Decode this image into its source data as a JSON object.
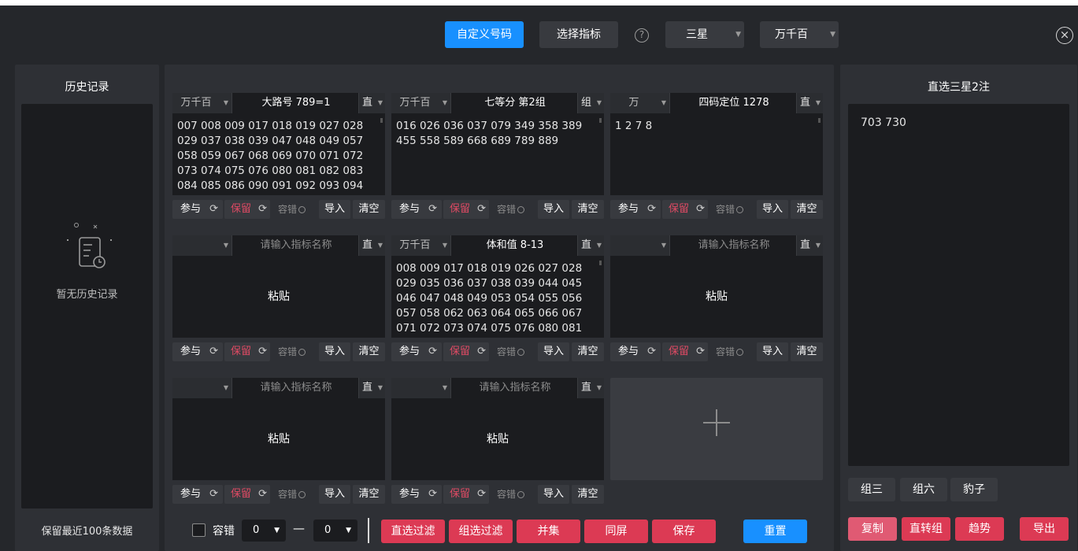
{
  "toolbar": {
    "custom_numbers": "自定义号码",
    "choose_indicator": "选择指标",
    "help": "?",
    "star_select": "三星",
    "position_select": "万千百",
    "close": "×"
  },
  "history": {
    "title": "历史记录",
    "empty": "暂无历史记录",
    "footer": "保留最近100条数据"
  },
  "cards": [
    {
      "pos": "万千百",
      "name": "大路号 789=1",
      "type": "直",
      "body": "007 008 009 017 018 019 027 028 029 037 038 039 047 048 049 057 058 059 067 068 069 070 071 072 073 074 075 076 080 081 082 083 084 085 086 090 091 092 093 094",
      "placeholder": false
    },
    {
      "pos": "万千百",
      "name": "七等分 第2组",
      "type": "组",
      "body": "016 026 036 037 079 349 358 389 455 558 589 668 689 789 889",
      "placeholder": false
    },
    {
      "pos": "万",
      "name": "四码定位 1278",
      "type": "直",
      "body": "1 2 7 8",
      "placeholder": false
    },
    {
      "pos": "",
      "name": "请输入指标名称",
      "type": "直",
      "body": "粘贴",
      "placeholder": true
    },
    {
      "pos": "万千百",
      "name": "体和值 8-13",
      "type": "直",
      "body": "008 009 017 018 019 026 027 028 029 035 036 037 038 039 044 045 046 047 048 049 053 054 055 056 057 058 062 063 064 065 066 067 071 072 073 074 075 076 080 081",
      "placeholder": false
    },
    {
      "pos": "",
      "name": "请输入指标名称",
      "type": "直",
      "body": "粘贴",
      "placeholder": true
    },
    {
      "pos": "",
      "name": "请输入指标名称",
      "type": "直",
      "body": "粘贴",
      "placeholder": true
    },
    {
      "pos": "",
      "name": "请输入指标名称",
      "type": "直",
      "body": "粘贴",
      "placeholder": true
    }
  ],
  "card_footer": {
    "join": "参与",
    "keep": "保留",
    "tolerance": "容错",
    "import": "导入",
    "clear": "清空"
  },
  "bottom": {
    "tolerance_label": "容错",
    "min": "0",
    "dash": "—",
    "max": "0",
    "direct_filter": "直选过滤",
    "group_filter": "组选过滤",
    "union": "并集",
    "same_screen": "同屏",
    "save": "保存",
    "reset": "重置"
  },
  "result": {
    "title": "直选三星2注",
    "content": "703 730",
    "group3": "组三",
    "group6": "组六",
    "leopard": "豹子",
    "copy": "复制",
    "to_group": "直转组",
    "trend": "趋势",
    "export": "导出"
  },
  "colors": {
    "accent_blue": "#1890ff",
    "accent_red": "#dc3a54",
    "background": "#25272b"
  }
}
